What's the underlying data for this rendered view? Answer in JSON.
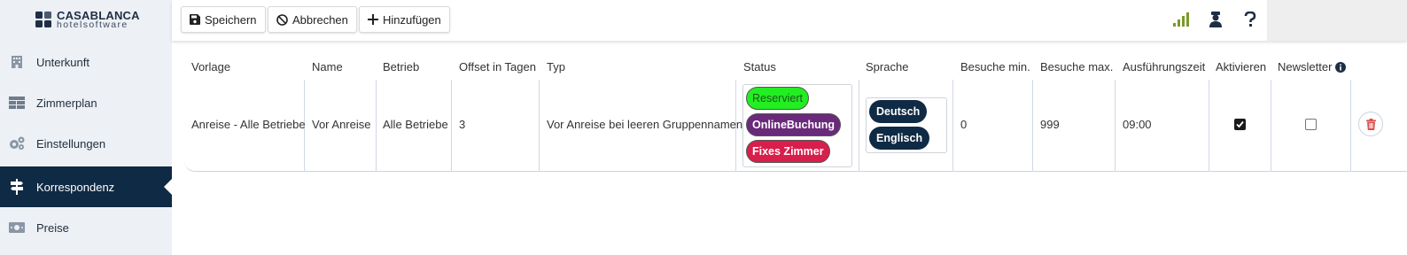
{
  "brand": {
    "name_line1": "CASABLANCA",
    "name_line2": "hotelsoftware"
  },
  "sidebar": {
    "items": [
      {
        "label": "Unterkunft",
        "icon": "building-icon",
        "active": false
      },
      {
        "label": "Zimmerplan",
        "icon": "floorplan-icon",
        "active": false
      },
      {
        "label": "Einstellungen",
        "icon": "gears-icon",
        "active": false
      },
      {
        "label": "Korrespondenz",
        "icon": "signpost-icon",
        "active": true
      },
      {
        "label": "Preise",
        "icon": "money-icon",
        "active": false
      }
    ]
  },
  "toolbar": {
    "save_label": "Speichern",
    "cancel_label": "Abbrechen",
    "add_label": "Hinzufügen"
  },
  "table": {
    "headers": {
      "vorlage": "Vorlage",
      "name": "Name",
      "betrieb": "Betrieb",
      "offset": "Offset in Tagen",
      "typ": "Typ",
      "status": "Status",
      "sprache": "Sprache",
      "besuche_min": "Besuche min.",
      "besuche_max": "Besuche max.",
      "ausfuehrungszeit": "Ausführungszeit",
      "aktivieren": "Aktivieren",
      "newsletter": "Newsletter"
    },
    "row": {
      "vorlage": "Anreise - Alle Betriebe",
      "name": "Vor Anreise",
      "betrieb": "Alle Betriebe",
      "offset": "3",
      "typ": "Vor Anreise bei leeren Gruppennamen",
      "status": [
        {
          "label": "Reserviert",
          "color": "#22ee22",
          "text_color": "#1a5a1a"
        },
        {
          "label": "OnlineBuchung",
          "color": "#6a2a7a",
          "text_color": "#ffffff"
        },
        {
          "label": "Fixes Zimmer",
          "color": "#d81e4a",
          "text_color": "#ffffff"
        }
      ],
      "sprache": [
        "Deutsch",
        "Englisch"
      ],
      "besuche_min": "0",
      "besuche_max": "999",
      "ausfuehrungszeit": "09:00",
      "aktivieren": true,
      "newsletter": false
    }
  },
  "colors": {
    "sidebar_bg": "#edf0f4",
    "active_nav": "#0f2a44",
    "signal_bars": "#7a9a2a",
    "delete_icon": "#d9534f"
  }
}
